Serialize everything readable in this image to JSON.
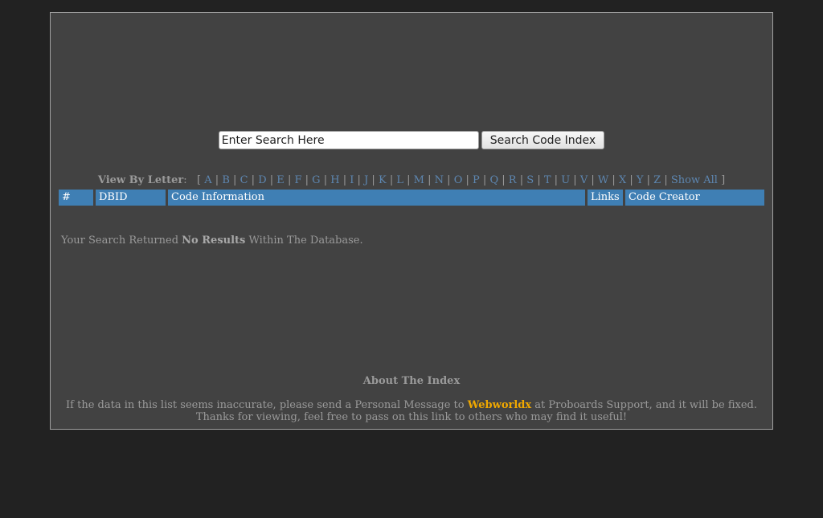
{
  "search": {
    "input_value": "Enter Search Here",
    "button_label": "Search Code Index"
  },
  "letter_nav": {
    "label": "View By Letter",
    "colon": ":",
    "open_bracket": "[",
    "close_bracket": "]",
    "separator": "|",
    "letters": [
      "A",
      "B",
      "C",
      "D",
      "E",
      "F",
      "G",
      "H",
      "I",
      "J",
      "K",
      "L",
      "M",
      "N",
      "O",
      "P",
      "Q",
      "R",
      "S",
      "T",
      "U",
      "V",
      "W",
      "X",
      "Y",
      "Z"
    ],
    "show_all": "Show All"
  },
  "table": {
    "columns": [
      "#",
      "DBID",
      "Code Information",
      "Links",
      "Code Creator"
    ]
  },
  "results": {
    "prefix": "Your Search Returned ",
    "emphasis": "No Results",
    "suffix": " Within The Database."
  },
  "about": {
    "title": "About The Index",
    "line1_prefix": "If the data in this list seems inaccurate, please send a Personal Message to ",
    "user": "Webworldx",
    "line1_suffix": " at Proboards Support, and it will be fixed.",
    "line2": "Thanks for viewing, feel free to pass on this link to others who may find it useful!"
  },
  "colors": {
    "page_background": "#222222",
    "panel_background": "#424242",
    "header_blue": "#3f7fb4",
    "link_blue": "#5d86b0",
    "highlight_orange": "#f0a800"
  }
}
